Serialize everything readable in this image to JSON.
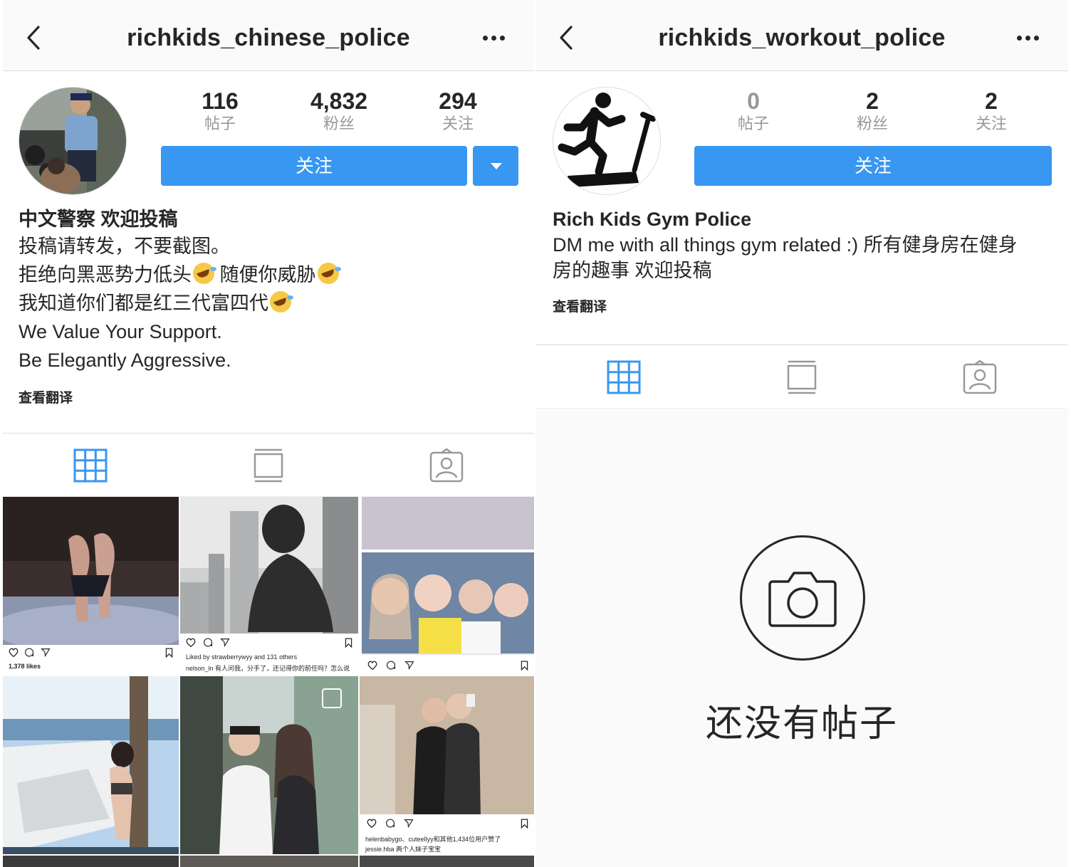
{
  "left": {
    "handle": "richkids_chinese_police",
    "stats": [
      {
        "num": "116",
        "label": "帖子"
      },
      {
        "num": "4,832",
        "label": "粉丝"
      },
      {
        "num": "294",
        "label": "关注"
      }
    ],
    "follow_label": "关注",
    "bio": {
      "name": "中文警察 欢迎投稿",
      "line1": "投稿请转发，不要截图。",
      "line2a": "拒绝向黑恶势力低头",
      "line2b": " 随便你威胁",
      "line3": "我知道你们都是红三代富四代",
      "line4": "We Value Your Support.",
      "line5": "Be Elegantly Aggressive."
    },
    "translate": "查看翻译",
    "posts": {
      "p1_caption": "1,378 likes",
      "p2_caption_a": "Liked by strawberrywyy and 131 others",
      "p2_caption_b": "nelson_ln 有人问我，分手了，还记得你的前任吗？怎么说",
      "p6_caption_a": "helenbabygo、cuteellyy和其他1,434位用户赞了",
      "p6_caption_b": "jessie.hba 两个人妹子宝宝"
    }
  },
  "right": {
    "handle": "richkids_workout_police",
    "stats": [
      {
        "num": "0",
        "label": "帖子"
      },
      {
        "num": "2",
        "label": "粉丝"
      },
      {
        "num": "2",
        "label": "关注"
      }
    ],
    "follow_label": "关注",
    "bio": {
      "name": "Rich Kids Gym Police",
      "line1": "DM me with all things gym related :) 所有健身房在健身",
      "line2": "房的趣事 欢迎投稿"
    },
    "translate": "查看翻译",
    "empty_text": "还没有帖子"
  },
  "icons": [
    "back-icon",
    "more-icon",
    "grid-icon",
    "feed-icon",
    "tagged-icon",
    "camera-icon",
    "heart-icon",
    "comment-icon",
    "share-icon",
    "bookmark-icon"
  ],
  "colors": {
    "accent": "#3897f0",
    "text": "#262626",
    "muted": "#999999",
    "border": "#dbdbdb"
  }
}
